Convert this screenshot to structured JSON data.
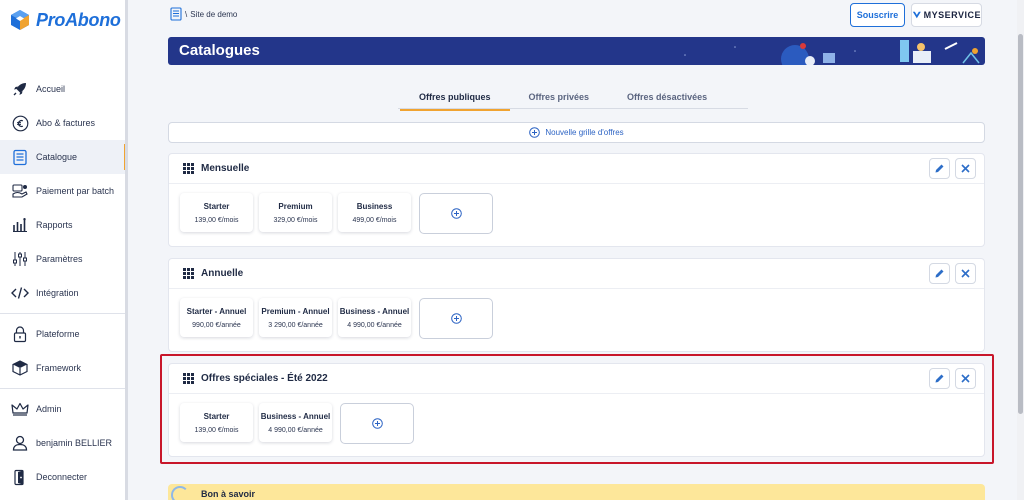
{
  "app": {
    "name": "ProAbono"
  },
  "sidebar": {
    "items": [
      {
        "id": "accueil",
        "label": "Accueil",
        "icon": "rocket-icon"
      },
      {
        "id": "abo",
        "label": "Abo & factures",
        "icon": "euro-icon"
      },
      {
        "id": "catalogue",
        "label": "Catalogue",
        "icon": "catalog-icon",
        "active": true
      },
      {
        "id": "batch",
        "label": "Paiement par batch",
        "icon": "batch-payment-icon"
      },
      {
        "id": "rapports",
        "label": "Rapports",
        "icon": "reports-icon"
      },
      {
        "id": "parametres",
        "label": "Paramètres",
        "icon": "sliders-icon"
      },
      {
        "id": "integration",
        "label": "Intégration",
        "icon": "code-icon"
      }
    ],
    "items2": [
      {
        "id": "plateforme",
        "label": "Plateforme",
        "icon": "lock-icon"
      },
      {
        "id": "framework",
        "label": "Framework",
        "icon": "cube-icon"
      }
    ],
    "items3": [
      {
        "id": "admin",
        "label": "Admin",
        "icon": "crown-icon"
      },
      {
        "id": "user",
        "label": "benjamin BELLIER",
        "icon": "user-icon"
      },
      {
        "id": "logout",
        "label": "Deconnecter",
        "icon": "logout-icon"
      }
    ]
  },
  "header": {
    "breadcrumb_sep": "\\",
    "breadcrumb": "Site de demo",
    "subscribe_label": "Souscrire",
    "brand_name": "MYSERVICE"
  },
  "banner": {
    "title": "Catalogues"
  },
  "tabs": [
    {
      "label": "Offres publiques",
      "active": true
    },
    {
      "label": "Offres privées"
    },
    {
      "label": "Offres désactivées"
    }
  ],
  "new_grid_label": "Nouvelle grille d'offres",
  "grids": [
    {
      "title": "Mensuelle",
      "offers": [
        {
          "name": "Starter",
          "price": "139,00 €/mois"
        },
        {
          "name": "Premium",
          "price": "329,00 €/mois"
        },
        {
          "name": "Business",
          "price": "499,00 €/mois"
        }
      ]
    },
    {
      "title": "Annuelle",
      "offers": [
        {
          "name": "Starter - Annuel",
          "price": "990,00 €/année"
        },
        {
          "name": "Premium - Annuel",
          "price": "3 290,00 €/année"
        },
        {
          "name": "Business - Annuel",
          "price": "4 990,00 €/année"
        }
      ]
    },
    {
      "title": "Offres spéciales - Été 2022",
      "offers": [
        {
          "name": "Starter",
          "price": "139,00 €/mois"
        },
        {
          "name": "Business - Annuel",
          "price": "4 990,00 €/année"
        }
      ]
    }
  ],
  "info": {
    "title": "Bon à savoir"
  },
  "colors": {
    "brand": "#1e6fd9",
    "banner": "#23368a",
    "accent": "#f0a330",
    "highlight": "#c8162a"
  }
}
